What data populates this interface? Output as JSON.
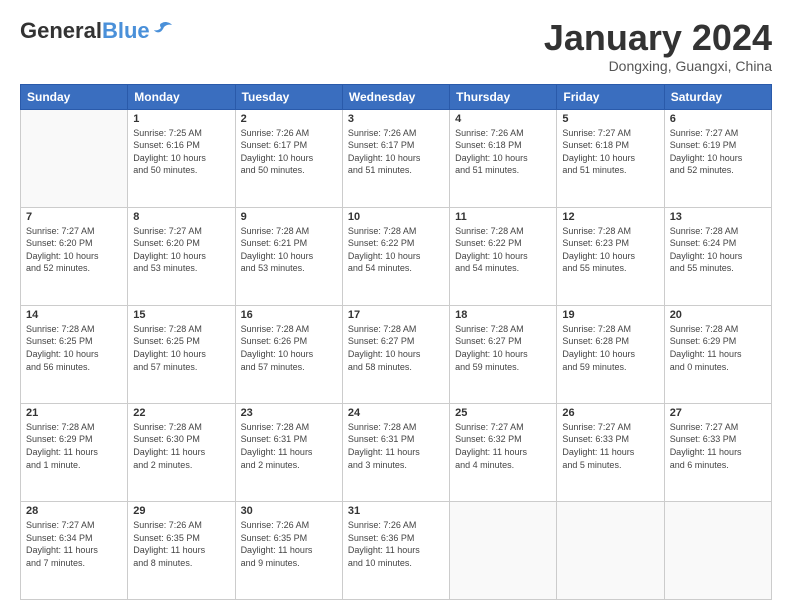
{
  "header": {
    "logo_general": "General",
    "logo_blue": "Blue",
    "month_title": "January 2024",
    "location": "Dongxing, Guangxi, China"
  },
  "days_of_week": [
    "Sunday",
    "Monday",
    "Tuesday",
    "Wednesday",
    "Thursday",
    "Friday",
    "Saturday"
  ],
  "weeks": [
    [
      {
        "day": "",
        "info": ""
      },
      {
        "day": "1",
        "info": "Sunrise: 7:25 AM\nSunset: 6:16 PM\nDaylight: 10 hours\nand 50 minutes."
      },
      {
        "day": "2",
        "info": "Sunrise: 7:26 AM\nSunset: 6:17 PM\nDaylight: 10 hours\nand 50 minutes."
      },
      {
        "day": "3",
        "info": "Sunrise: 7:26 AM\nSunset: 6:17 PM\nDaylight: 10 hours\nand 51 minutes."
      },
      {
        "day": "4",
        "info": "Sunrise: 7:26 AM\nSunset: 6:18 PM\nDaylight: 10 hours\nand 51 minutes."
      },
      {
        "day": "5",
        "info": "Sunrise: 7:27 AM\nSunset: 6:18 PM\nDaylight: 10 hours\nand 51 minutes."
      },
      {
        "day": "6",
        "info": "Sunrise: 7:27 AM\nSunset: 6:19 PM\nDaylight: 10 hours\nand 52 minutes."
      }
    ],
    [
      {
        "day": "7",
        "info": "Sunrise: 7:27 AM\nSunset: 6:20 PM\nDaylight: 10 hours\nand 52 minutes."
      },
      {
        "day": "8",
        "info": "Sunrise: 7:27 AM\nSunset: 6:20 PM\nDaylight: 10 hours\nand 53 minutes."
      },
      {
        "day": "9",
        "info": "Sunrise: 7:28 AM\nSunset: 6:21 PM\nDaylight: 10 hours\nand 53 minutes."
      },
      {
        "day": "10",
        "info": "Sunrise: 7:28 AM\nSunset: 6:22 PM\nDaylight: 10 hours\nand 54 minutes."
      },
      {
        "day": "11",
        "info": "Sunrise: 7:28 AM\nSunset: 6:22 PM\nDaylight: 10 hours\nand 54 minutes."
      },
      {
        "day": "12",
        "info": "Sunrise: 7:28 AM\nSunset: 6:23 PM\nDaylight: 10 hours\nand 55 minutes."
      },
      {
        "day": "13",
        "info": "Sunrise: 7:28 AM\nSunset: 6:24 PM\nDaylight: 10 hours\nand 55 minutes."
      }
    ],
    [
      {
        "day": "14",
        "info": "Sunrise: 7:28 AM\nSunset: 6:25 PM\nDaylight: 10 hours\nand 56 minutes."
      },
      {
        "day": "15",
        "info": "Sunrise: 7:28 AM\nSunset: 6:25 PM\nDaylight: 10 hours\nand 57 minutes."
      },
      {
        "day": "16",
        "info": "Sunrise: 7:28 AM\nSunset: 6:26 PM\nDaylight: 10 hours\nand 57 minutes."
      },
      {
        "day": "17",
        "info": "Sunrise: 7:28 AM\nSunset: 6:27 PM\nDaylight: 10 hours\nand 58 minutes."
      },
      {
        "day": "18",
        "info": "Sunrise: 7:28 AM\nSunset: 6:27 PM\nDaylight: 10 hours\nand 59 minutes."
      },
      {
        "day": "19",
        "info": "Sunrise: 7:28 AM\nSunset: 6:28 PM\nDaylight: 10 hours\nand 59 minutes."
      },
      {
        "day": "20",
        "info": "Sunrise: 7:28 AM\nSunset: 6:29 PM\nDaylight: 11 hours\nand 0 minutes."
      }
    ],
    [
      {
        "day": "21",
        "info": "Sunrise: 7:28 AM\nSunset: 6:29 PM\nDaylight: 11 hours\nand 1 minute."
      },
      {
        "day": "22",
        "info": "Sunrise: 7:28 AM\nSunset: 6:30 PM\nDaylight: 11 hours\nand 2 minutes."
      },
      {
        "day": "23",
        "info": "Sunrise: 7:28 AM\nSunset: 6:31 PM\nDaylight: 11 hours\nand 2 minutes."
      },
      {
        "day": "24",
        "info": "Sunrise: 7:28 AM\nSunset: 6:31 PM\nDaylight: 11 hours\nand 3 minutes."
      },
      {
        "day": "25",
        "info": "Sunrise: 7:27 AM\nSunset: 6:32 PM\nDaylight: 11 hours\nand 4 minutes."
      },
      {
        "day": "26",
        "info": "Sunrise: 7:27 AM\nSunset: 6:33 PM\nDaylight: 11 hours\nand 5 minutes."
      },
      {
        "day": "27",
        "info": "Sunrise: 7:27 AM\nSunset: 6:33 PM\nDaylight: 11 hours\nand 6 minutes."
      }
    ],
    [
      {
        "day": "28",
        "info": "Sunrise: 7:27 AM\nSunset: 6:34 PM\nDaylight: 11 hours\nand 7 minutes."
      },
      {
        "day": "29",
        "info": "Sunrise: 7:26 AM\nSunset: 6:35 PM\nDaylight: 11 hours\nand 8 minutes."
      },
      {
        "day": "30",
        "info": "Sunrise: 7:26 AM\nSunset: 6:35 PM\nDaylight: 11 hours\nand 9 minutes."
      },
      {
        "day": "31",
        "info": "Sunrise: 7:26 AM\nSunset: 6:36 PM\nDaylight: 11 hours\nand 10 minutes."
      },
      {
        "day": "",
        "info": ""
      },
      {
        "day": "",
        "info": ""
      },
      {
        "day": "",
        "info": ""
      }
    ]
  ]
}
